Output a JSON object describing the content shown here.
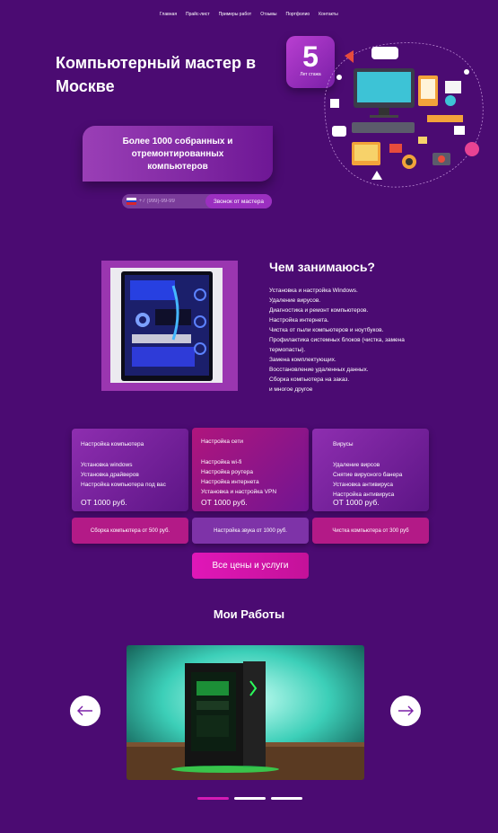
{
  "nav": [
    "Главная",
    "Прайс-лист",
    "Примеры работ",
    "Отзывы",
    "Портфолио",
    "Контакты"
  ],
  "hero": {
    "title": "Компьютерный мастер в Москве",
    "experience_number": "5",
    "experience_label": "Лет стажа",
    "badge": "Более 1000 собранных и отремонтированных компьютеров",
    "phone_placeholder": "+7 (999)-99-99",
    "callback_button": "Звонок от мастера"
  },
  "services": {
    "title": "Чем занимаюсь?",
    "items": [
      "Установка и настройка Windows.",
      "Удаление вирусов.",
      "Диагностика и ремонт компьютеров.",
      "Настройка интернета.",
      "Чистка от пыли компьютеров и ноутбуков.",
      "Профилактика системных блоков (чистка, замена термопасты).",
      "Замена комплектующих.",
      "Восстановление удаленных данных.",
      "Сборка компьютера на заказ.",
      "и многое другое"
    ]
  },
  "price_cards": [
    {
      "title": "Настройка компьютера",
      "items": [
        "Установка windows",
        "Установка драйверов",
        "Настройка компьютера под вас"
      ],
      "price": "ОТ 1000 руб."
    },
    {
      "title": "Настройка сети",
      "items": [
        "Настройка wi-fi",
        "Настройка роутера",
        "Настройка интернета",
        "Установка и настройка VPN"
      ],
      "price": "ОТ 1000 руб."
    },
    {
      "title": "Вирусы",
      "items": [
        "Удаление вирсов",
        "Снятие вирусного банера",
        "Установка антивируса",
        "Настройка антивируса"
      ],
      "price": "ОТ 1000 руб."
    }
  ],
  "small_buttons": [
    "Сборка компьютера от 500 руб.",
    "Настройка звука от 1000 руб.",
    "Чистка компьютера от 300 руб"
  ],
  "all_prices_button": "Все цены и услуги",
  "works": {
    "title": "Мои Работы"
  },
  "colors": {
    "background": "#4b0b72",
    "accent": "#d41bb4",
    "card": "#8e2eb0"
  },
  "icons": [
    "arrow-left-icon",
    "arrow-right-icon",
    "russia-flag-icon"
  ]
}
